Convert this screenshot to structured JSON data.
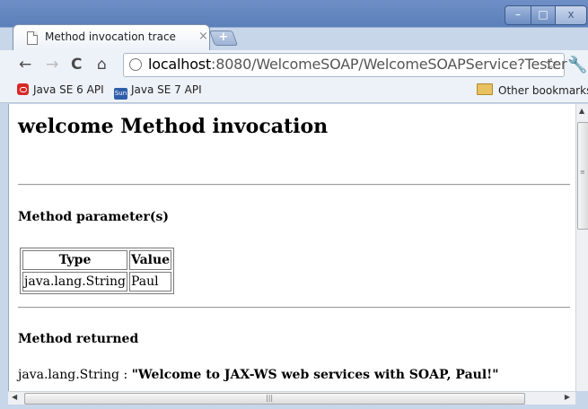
{
  "window": {
    "tab_title": "Method invocation trace",
    "tab_close_glyph": "×",
    "new_tab_glyph": "+",
    "minimize_glyph": "–",
    "maximize_glyph": "□",
    "close_glyph": "x"
  },
  "toolbar": {
    "back_glyph": "←",
    "forward_glyph": "→",
    "reload_glyph": "C",
    "home_glyph": "⌂",
    "url_host": "localhost",
    "url_rest": ":8080/WelcomeSOAP/WelcomeSOAPService?Tester",
    "star_glyph": "☆",
    "wrench_glyph": "🔧"
  },
  "bookmarks": {
    "items": [
      {
        "label": "Java SE 6 API",
        "icon": "oracle-icon"
      },
      {
        "label": "Java SE 7 API",
        "icon": "sun-icon"
      }
    ],
    "sun_icon_text": "Sun",
    "other_label": "Other bookmarks"
  },
  "page": {
    "heading": "welcome Method invocation",
    "params_heading": "Method parameter(s)",
    "table": {
      "headers": [
        "Type",
        "Value"
      ],
      "rows": [
        [
          "java.lang.String",
          "Paul"
        ]
      ]
    },
    "returned_heading": "Method returned",
    "result_type": "java.lang.String : ",
    "result_value": "\"Welcome to JAX-WS web services with SOAP, Paul!\""
  },
  "scrollbars": {
    "v_up": "▲",
    "v_grip": "≡",
    "h_left": "◀",
    "h_right": "▶",
    "h_grip": "|||"
  }
}
